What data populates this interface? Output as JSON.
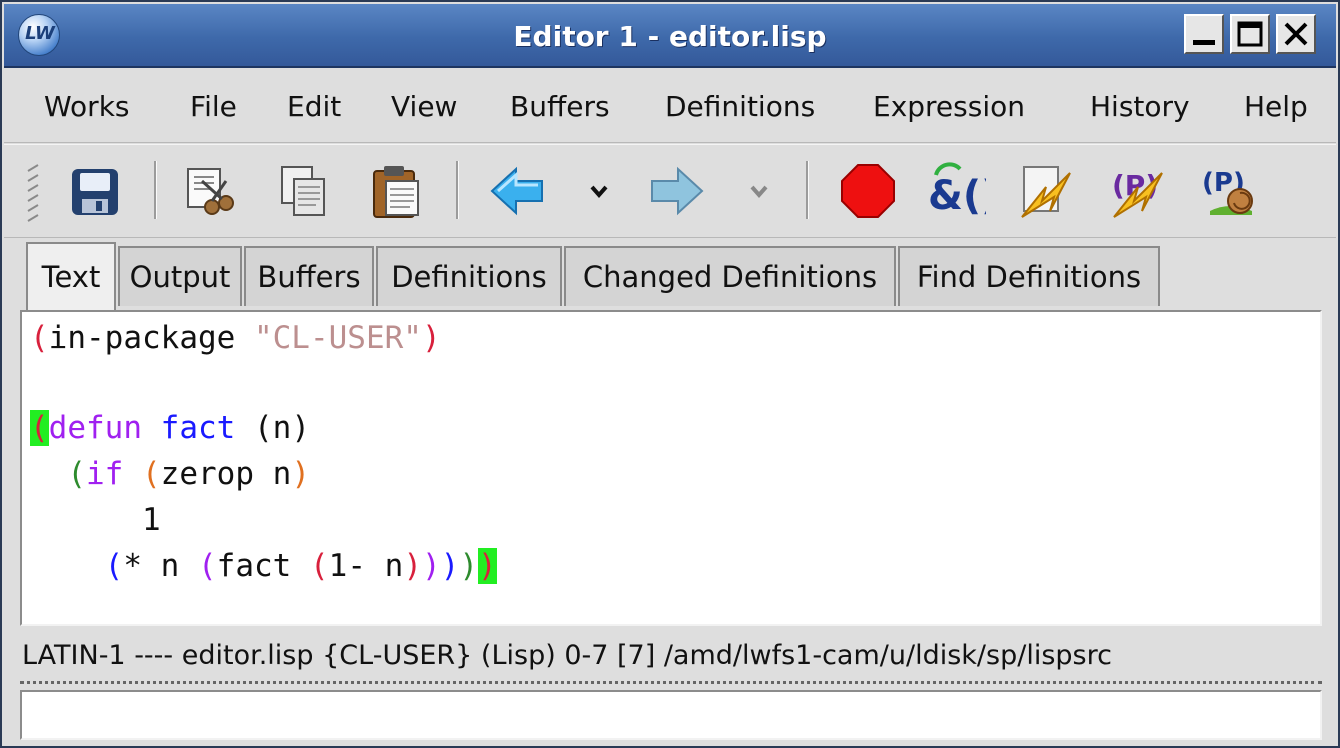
{
  "window": {
    "title": "Editor 1 - editor.lisp",
    "logo_text": "LW"
  },
  "menubar": {
    "items": [
      {
        "label": "Works"
      },
      {
        "label": "File"
      },
      {
        "label": "Edit"
      },
      {
        "label": "View"
      },
      {
        "label": "Buffers"
      },
      {
        "label": "Definitions"
      },
      {
        "label": "Expression"
      },
      {
        "label": "History"
      },
      {
        "label": "Help"
      }
    ]
  },
  "toolbar": {
    "icons": [
      "save-icon",
      "cut-icon",
      "copy-icon",
      "paste-icon",
      "back-arrow-icon",
      "dropdown-icon",
      "forward-arrow-icon",
      "dropdown-icon",
      "stop-icon",
      "evaluate-icon",
      "compile-icon",
      "compile-buffer-icon",
      "step-icon"
    ]
  },
  "tabs": {
    "items": [
      {
        "label": "Text",
        "active": true
      },
      {
        "label": "Output"
      },
      {
        "label": "Buffers"
      },
      {
        "label": "Definitions"
      },
      {
        "label": "Changed Definitions"
      },
      {
        "label": "Find Definitions"
      }
    ]
  },
  "editor": {
    "lines": [
      "(in-package \"CL-USER\")",
      "",
      "(defun fact (n)",
      "  (if (zerop n)",
      "      1",
      "    (* n (fact (1- n)))))"
    ],
    "colors": {
      "paren_red": "#d8203c",
      "string": "#bc8f8f",
      "keyword_purple": "#a020f0",
      "function_blue": "#1a1aff",
      "paren_orange": "#e07020",
      "paren_green": "#2e8b2e",
      "match_highlight": "#22ee22"
    }
  },
  "status": {
    "text": "LATIN-1 ---- editor.lisp    {CL-USER} (Lisp) 0-7 [7] /amd/lwfs1-cam/u/ldisk/sp/lispsrc"
  },
  "echo_area": {
    "value": ""
  }
}
